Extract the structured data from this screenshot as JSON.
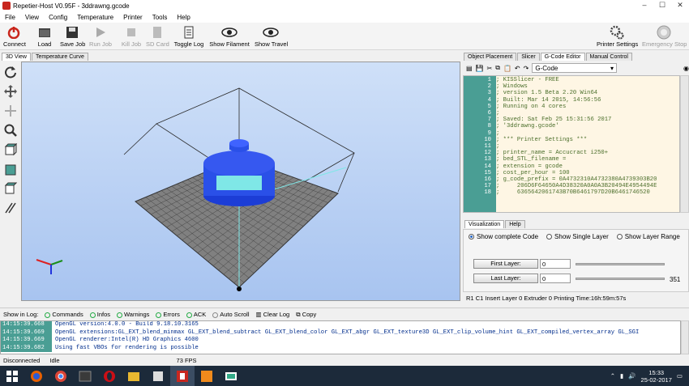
{
  "app": {
    "title": "Repetier-Host V0.95F - 3ddrawng.gcode"
  },
  "window_controls": {
    "minimize": "–",
    "maximize": "☐",
    "close": "✕"
  },
  "menu": [
    "File",
    "View",
    "Config",
    "Temperature",
    "Printer",
    "Tools",
    "Help"
  ],
  "toolbar": {
    "connect": "Connect",
    "load": "Load",
    "save_job": "Save Job",
    "run_job": "Run Job",
    "kill_job": "Kill Job",
    "sd_card": "SD Card",
    "toggle_log": "Toggle Log",
    "show_filament": "Show Filament",
    "show_travel": "Show Travel",
    "printer_settings": "Printer Settings",
    "emergency_stop": "Emergency Stop"
  },
  "left_tabs": [
    "3D View",
    "Temperature Curve"
  ],
  "right_tabs": [
    "Object Placement",
    "Slicer",
    "G-Code Editor",
    "Manual Control"
  ],
  "gcode": {
    "selector": "G-Code",
    "lines": [
      {
        "n": "1",
        "t": "; KISSlicer - FREE"
      },
      {
        "n": "2",
        "t": "; Windows"
      },
      {
        "n": "3",
        "t": "; version 1.5 Beta 2.20 Win64"
      },
      {
        "n": "4",
        "t": "; Built: Mar 14 2015, 14:56:56"
      },
      {
        "n": "5",
        "t": "; Running on 4 cores"
      },
      {
        "n": "6",
        "t": ";"
      },
      {
        "n": "7",
        "t": "; Saved: Sat Feb 25 15:31:56 2017"
      },
      {
        "n": "8",
        "t": "; '3ddrawng.gcode'"
      },
      {
        "n": "9",
        "t": ";"
      },
      {
        "n": "10",
        "t": "; *** Printer Settings ***"
      },
      {
        "n": "11",
        "t": ";"
      },
      {
        "n": "12",
        "t": "; printer_name = Accucract i250+"
      },
      {
        "n": "13",
        "t": "; bed_STL_filename ="
      },
      {
        "n": "14",
        "t": "; extension = gcode"
      },
      {
        "n": "15",
        "t": "; cost_per_hour = 100"
      },
      {
        "n": "16",
        "t": "; g_code_prefix = 0A4732310A4732380A4739303B20"
      },
      {
        "n": "17",
        "t": ";     206D6F64650A4D38320A0A0A3B20494E4954494E"
      },
      {
        "n": "18",
        "t": ";     6365642061743B70B6461797D20B6461746520"
      }
    ]
  },
  "viz": {
    "tabs": [
      "Visualization",
      "Help"
    ],
    "opt1": "Show complete Code",
    "opt2": "Show Single Layer",
    "opt3": "Show Layer Range",
    "first_layer": "First Layer:",
    "last_layer": "Last Layer:",
    "first_val": "0",
    "last_val": "0",
    "last_max": "351"
  },
  "status_right": {
    "r1": "R1",
    "c1": "C1",
    "insert": "Insert",
    "layer": "Layer 0",
    "extruder": "Extruder 0",
    "time": "Printing Time:16h:59m:57s"
  },
  "logbar": {
    "show": "Show in Log:",
    "commands": "Commands",
    "infos": "Infos",
    "warnings": "Warnings",
    "errors": "Errors",
    "ack": "ACK",
    "autoscroll": "Auto Scroll",
    "clear": "Clear Log",
    "copy": "Copy"
  },
  "log": [
    {
      "ts": "14:15:39.668",
      "msg": "OpenGL version:4.0.0 - Build 9.18.10.3165"
    },
    {
      "ts": "14:15:39.669",
      "msg": "OpenGL extensions:GL_EXT_blend_minmax GL_EXT_blend_subtract GL_EXT_blend_color GL_EXT_abgr GL_EXT_texture3D GL_EXT_clip_volume_hint GL_EXT_compiled_vertex_array GL_SGI"
    },
    {
      "ts": "14:15:39.669",
      "msg": "OpenGL renderer:Intel(R) HD Graphics 4600"
    },
    {
      "ts": "14:15:39.682",
      "msg": "Using fast VBOs for rendering is possible"
    }
  ],
  "status": {
    "conn": "Disconnected",
    "idle": "Idle",
    "fps": "73 FPS"
  },
  "clock": {
    "time": "15:33",
    "date": "25-02-2017"
  },
  "colors": {
    "accent": "#4a9e94",
    "object": "#2a50e8"
  }
}
